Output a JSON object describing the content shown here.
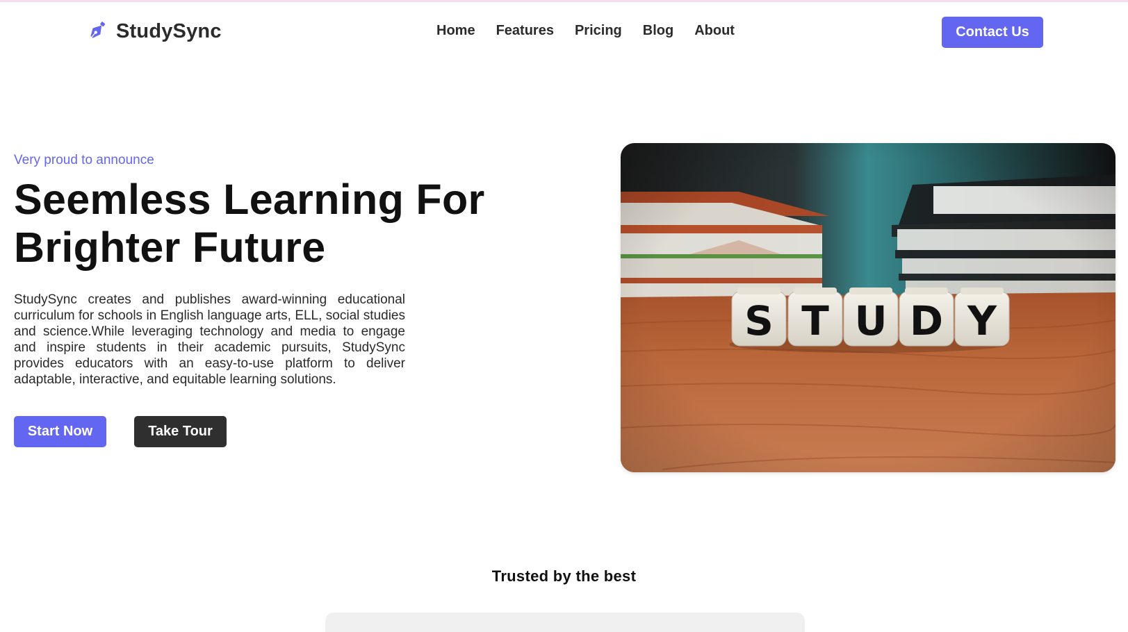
{
  "brand": {
    "name": "StudySync",
    "icon": "pen-nib-icon",
    "accent_color": "#6366f1"
  },
  "nav": {
    "links": [
      "Home",
      "Features",
      "Pricing",
      "Blog",
      "About"
    ],
    "cta_label": "Contact Us"
  },
  "hero": {
    "eyebrow": "Very proud to announce",
    "title_line1": "Seemless Learning For",
    "title_line2": "Brighter Future",
    "description": "StudySync creates and publishes award-winning educational curriculum for schools in English language arts, ELL, social studies and science.While leveraging technology and media to engage and inspire students in their academic pursuits, StudySync provides educators with an easy-to-use platform to deliver adaptable, interactive, and equitable learning solutions.",
    "primary_button": "Start Now",
    "secondary_button": "Take Tour",
    "image": {
      "letters": [
        "S",
        "T",
        "U",
        "D",
        "Y"
      ]
    }
  },
  "trusted": {
    "title": "Trusted by the best"
  },
  "colors": {
    "primary": "#6366f1",
    "dark_button": "#2f2f2f",
    "text": "#111111"
  }
}
